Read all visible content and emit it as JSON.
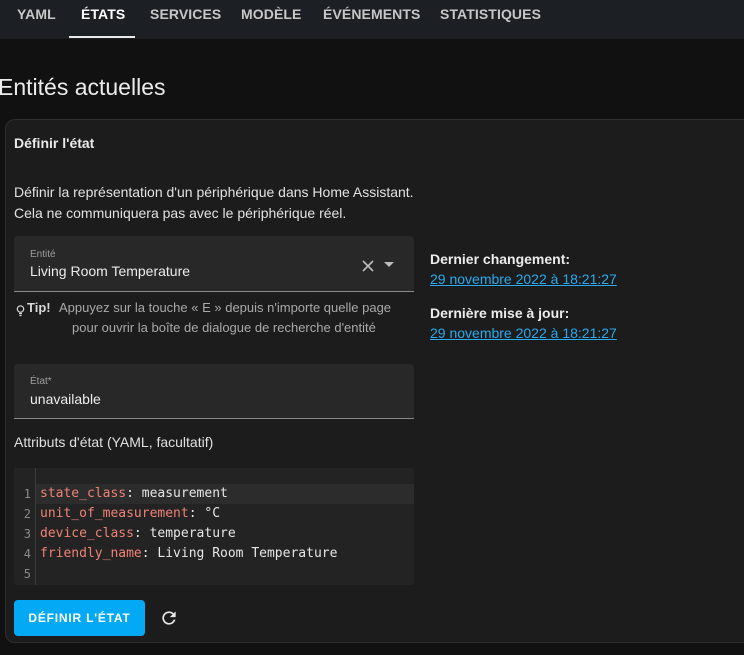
{
  "tabs": [
    "YAML",
    "ÉTATS",
    "SERVICES",
    "MODÈLE",
    "ÉVÉNEMENTS",
    "STATISTIQUES"
  ],
  "active_tab": "ÉTATS",
  "page_title": "Entités actuelles",
  "card": {
    "heading": "Définir l'état",
    "description_line1": "Définir la représentation d'un périphérique dans Home Assistant.",
    "description_line2": "Cela ne communiquera pas avec le périphérique réel."
  },
  "entity_field": {
    "label": "Entité",
    "value": "Living Room Temperature"
  },
  "tip": {
    "title": "Tip!",
    "line1": "Appuyez sur la touche « E » depuis n'importe quelle page",
    "line2": "pour ouvrir la boîte de dialogue de recherche d'entité"
  },
  "state_field": {
    "label": "État*",
    "value": "unavailable"
  },
  "attributes_label": "Attributs d'état (YAML, facultatif)",
  "yaml_lines": [
    {
      "num": "1",
      "key": "state_class",
      "value": "measurement"
    },
    {
      "num": "2",
      "key": "unit_of_measurement",
      "value": "°C"
    },
    {
      "num": "3",
      "key": "device_class",
      "value": "temperature"
    },
    {
      "num": "4",
      "key": "friendly_name",
      "value": "Living Room Temperature"
    },
    {
      "num": "5",
      "key": "",
      "value": ""
    }
  ],
  "last_changed": {
    "label": "Dernier changement:",
    "value": "29 novembre 2022 à 18:21:27"
  },
  "last_updated": {
    "label": "Dernière mise à jour:",
    "value": "29 novembre 2022 à 18:21:27"
  },
  "set_state_button": "DÉFINIR L'ÉTAT",
  "colors": {
    "accent": "#03a9f4",
    "link": "#2ba9ee",
    "yaml_key": "#ef8277"
  }
}
